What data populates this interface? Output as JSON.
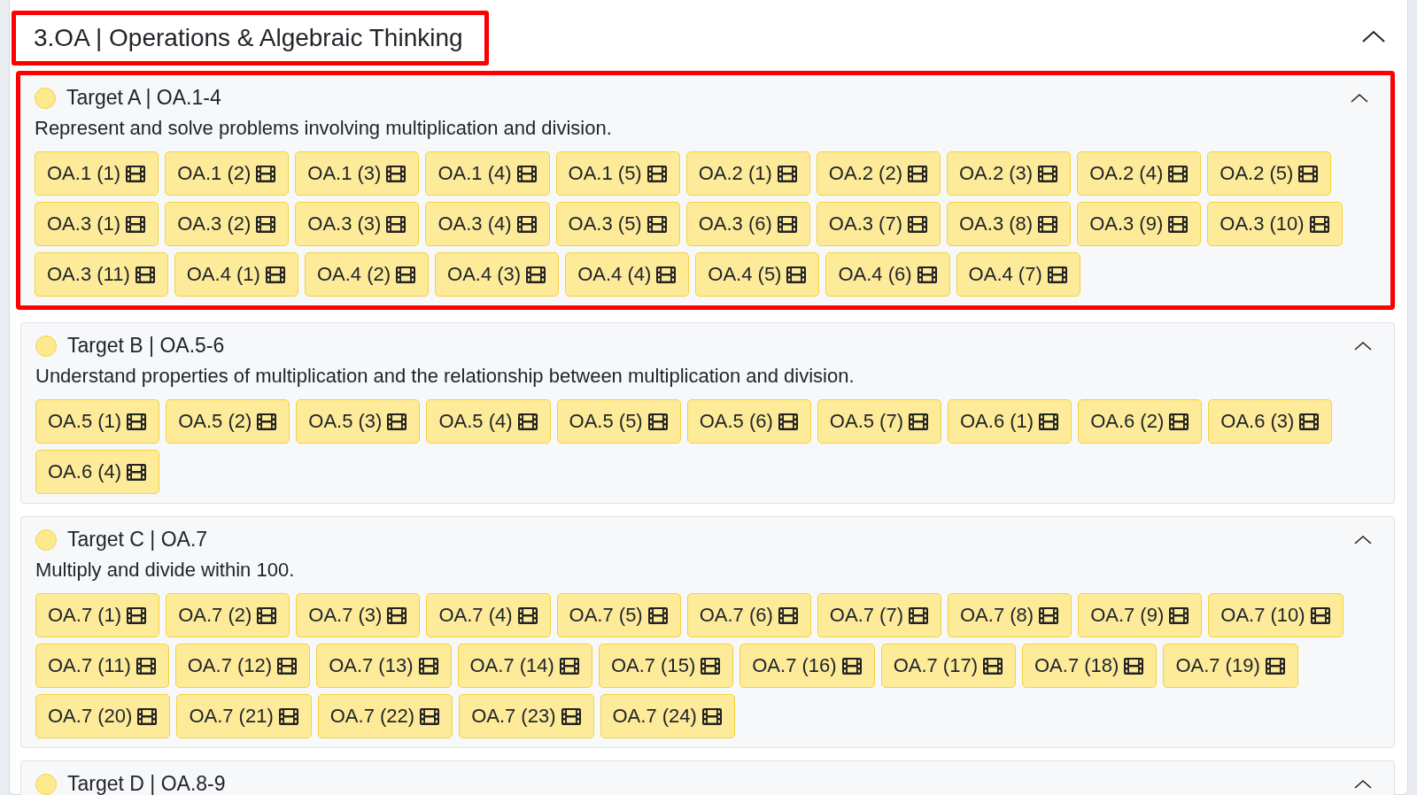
{
  "section": {
    "title": "3.OA | Operations & Algebraic Thinking",
    "highlighted": true,
    "expanded": true
  },
  "targets": [
    {
      "title": "Target A | OA.1-4",
      "description": "Represent and solve problems involving multiplication and division.",
      "highlighted": true,
      "expanded": true,
      "chips": [
        "OA.1 (1)",
        "OA.1 (2)",
        "OA.1 (3)",
        "OA.1 (4)",
        "OA.1 (5)",
        "OA.2 (1)",
        "OA.2 (2)",
        "OA.2 (3)",
        "OA.2 (4)",
        "OA.2 (5)",
        "OA.3 (1)",
        "OA.3 (2)",
        "OA.3 (3)",
        "OA.3 (4)",
        "OA.3 (5)",
        "OA.3 (6)",
        "OA.3 (7)",
        "OA.3 (8)",
        "OA.3 (9)",
        "OA.3 (10)",
        "OA.3 (11)",
        "OA.4 (1)",
        "OA.4 (2)",
        "OA.4 (3)",
        "OA.4 (4)",
        "OA.4 (5)",
        "OA.4 (6)",
        "OA.4 (7)"
      ]
    },
    {
      "title": "Target B | OA.5-6",
      "description": "Understand properties of multiplication and the relationship between multiplication and division.",
      "highlighted": false,
      "expanded": true,
      "chips": [
        "OA.5 (1)",
        "OA.5 (2)",
        "OA.5 (3)",
        "OA.5 (4)",
        "OA.5 (5)",
        "OA.5 (6)",
        "OA.5 (7)",
        "OA.6 (1)",
        "OA.6 (2)",
        "OA.6 (3)",
        "OA.6 (4)"
      ]
    },
    {
      "title": "Target C | OA.7",
      "description": "Multiply and divide within 100.",
      "highlighted": false,
      "expanded": true,
      "chips": [
        "OA.7 (1)",
        "OA.7 (2)",
        "OA.7 (3)",
        "OA.7 (4)",
        "OA.7 (5)",
        "OA.7 (6)",
        "OA.7 (7)",
        "OA.7 (8)",
        "OA.7 (9)",
        "OA.7 (10)",
        "OA.7 (11)",
        "OA.7 (12)",
        "OA.7 (13)",
        "OA.7 (14)",
        "OA.7 (15)",
        "OA.7 (16)",
        "OA.7 (17)",
        "OA.7 (18)",
        "OA.7 (19)",
        "OA.7 (20)",
        "OA.7 (21)",
        "OA.7 (22)",
        "OA.7 (23)",
        "OA.7 (24)"
      ]
    },
    {
      "title": "Target D | OA.8-9",
      "highlighted": false,
      "expanded": true
    }
  ]
}
